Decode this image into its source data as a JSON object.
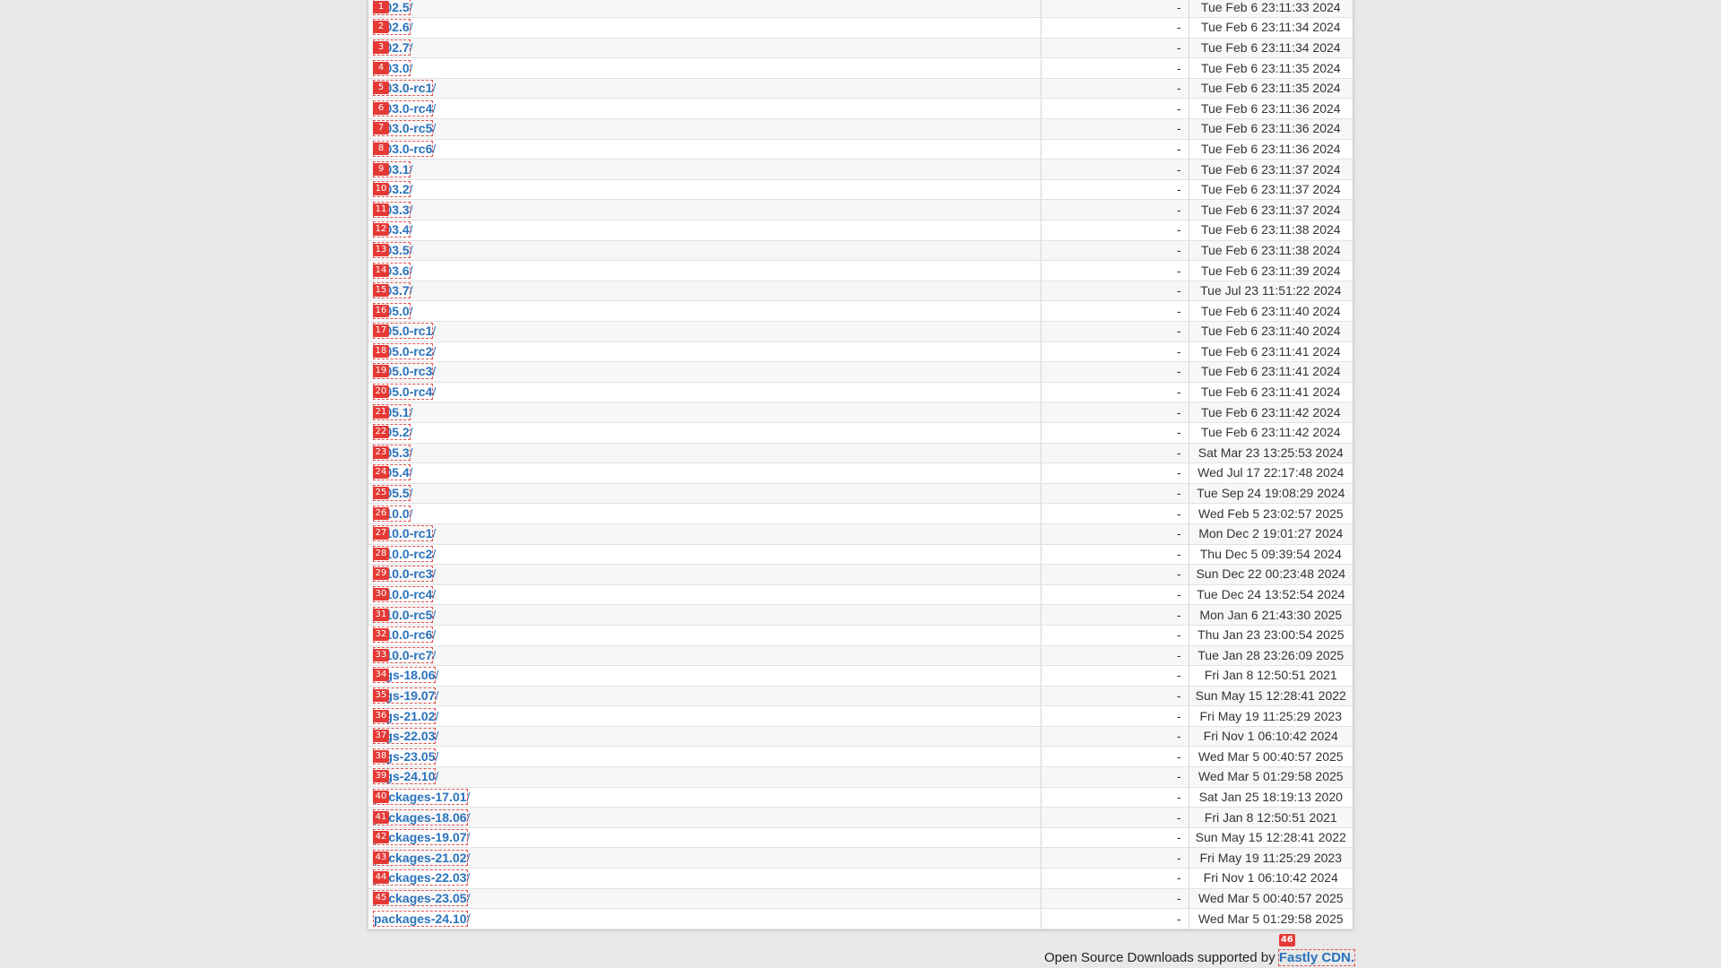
{
  "rows": [
    {
      "badge": "1",
      "name": "s-02.5",
      "size": "-",
      "date": "Tue Feb 6 23:11:33 2024"
    },
    {
      "badge": "2",
      "name": "s-02.6",
      "size": "-",
      "date": "Tue Feb 6 23:11:34 2024"
    },
    {
      "badge": "3",
      "name": "s-02.7",
      "size": "-",
      "date": "Tue Feb 6 23:11:34 2024"
    },
    {
      "badge": "4",
      "name": "s-03.0",
      "size": "-",
      "date": "Tue Feb 6 23:11:35 2024"
    },
    {
      "badge": "5",
      "name": "s-03.0-rc1",
      "size": "-",
      "date": "Tue Feb 6 23:11:35 2024"
    },
    {
      "badge": "6",
      "name": "s-03.0-rc4",
      "size": "-",
      "date": "Tue Feb 6 23:11:36 2024"
    },
    {
      "badge": "7",
      "name": "s-03.0-rc5",
      "size": "-",
      "date": "Tue Feb 6 23:11:36 2024"
    },
    {
      "badge": "8",
      "name": "s-03.0-rc6",
      "size": "-",
      "date": "Tue Feb 6 23:11:36 2024"
    },
    {
      "badge": "9",
      "name": "s-03.1",
      "size": "-",
      "date": "Tue Feb 6 23:11:37 2024"
    },
    {
      "badge": "10",
      "name": "s-03.2",
      "size": "-",
      "date": "Tue Feb 6 23:11:37 2024"
    },
    {
      "badge": "11",
      "name": "s-03.3",
      "size": "-",
      "date": "Tue Feb 6 23:11:37 2024"
    },
    {
      "badge": "12",
      "name": "s-03.4",
      "size": "-",
      "date": "Tue Feb 6 23:11:38 2024"
    },
    {
      "badge": "13",
      "name": "s-03.5",
      "size": "-",
      "date": "Tue Feb 6 23:11:38 2024"
    },
    {
      "badge": "14",
      "name": "s-03.6",
      "size": "-",
      "date": "Tue Feb 6 23:11:39 2024"
    },
    {
      "badge": "15",
      "name": "s-03.7",
      "size": "-",
      "date": "Tue Jul 23 11:51:22 2024"
    },
    {
      "badge": "16",
      "name": "s-05.0",
      "size": "-",
      "date": "Tue Feb 6 23:11:40 2024"
    },
    {
      "badge": "17",
      "name": "s-05.0-rc1",
      "size": "-",
      "date": "Tue Feb 6 23:11:40 2024"
    },
    {
      "badge": "18",
      "name": "s-05.0-rc2",
      "size": "-",
      "date": "Tue Feb 6 23:11:41 2024"
    },
    {
      "badge": "19",
      "name": "s-05.0-rc3",
      "size": "-",
      "date": "Tue Feb 6 23:11:41 2024"
    },
    {
      "badge": "20",
      "name": "s-05.0-rc4",
      "size": "-",
      "date": "Tue Feb 6 23:11:41 2024"
    },
    {
      "badge": "21",
      "name": "s-05.1",
      "size": "-",
      "date": "Tue Feb 6 23:11:42 2024"
    },
    {
      "badge": "22",
      "name": "s-05.2",
      "size": "-",
      "date": "Tue Feb 6 23:11:42 2024"
    },
    {
      "badge": "23",
      "name": "s-05.3",
      "size": "-",
      "date": "Sat Mar 23 13:25:53 2024"
    },
    {
      "badge": "24",
      "name": "s-05.4",
      "size": "-",
      "date": "Wed Jul 17 22:17:48 2024"
    },
    {
      "badge": "25",
      "name": "s-05.5",
      "size": "-",
      "date": "Tue Sep 24 19:08:29 2024"
    },
    {
      "badge": "26",
      "name": "s-10.0",
      "size": "-",
      "date": "Wed Feb 5 23:02:57 2025"
    },
    {
      "badge": "27",
      "name": "s-10.0-rc1",
      "size": "-",
      "date": "Mon Dec 2 19:01:27 2024"
    },
    {
      "badge": "28",
      "name": "s-10.0-rc2",
      "size": "-",
      "date": "Thu Dec 5 09:39:54 2024"
    },
    {
      "badge": "29",
      "name": "s-10.0-rc3",
      "size": "-",
      "date": "Sun Dec 22 00:23:48 2024"
    },
    {
      "badge": "30",
      "name": "s-10.0-rc4",
      "size": "-",
      "date": "Tue Dec 24 13:52:54 2024"
    },
    {
      "badge": "31",
      "name": "s-10.0-rc5",
      "size": "-",
      "date": "Mon Jan 6 21:43:30 2025"
    },
    {
      "badge": "32",
      "name": "s-10.0-rc6",
      "size": "-",
      "date": "Thu Jan 23 23:00:54 2025"
    },
    {
      "badge": "33",
      "name": "s-10.0-rc7",
      "size": "-",
      "date": "Tue Jan 28 23:26:09 2025"
    },
    {
      "badge": "34",
      "name": "logs-18.06",
      "size": "-",
      "date": "Fri Jan 8 12:50:51 2021"
    },
    {
      "badge": "35",
      "name": "logs-19.07",
      "size": "-",
      "date": "Sun May 15 12:28:41 2022"
    },
    {
      "badge": "36",
      "name": "logs-21.02",
      "size": "-",
      "date": "Fri May 19 11:25:29 2023"
    },
    {
      "badge": "37",
      "name": "logs-22.03",
      "size": "-",
      "date": "Fri Nov 1 06:10:42 2024"
    },
    {
      "badge": "38",
      "name": "logs-23.05",
      "size": "-",
      "date": "Wed Mar 5 00:40:57 2025"
    },
    {
      "badge": "39",
      "name": "logs-24.10",
      "size": "-",
      "date": "Wed Mar 5 01:29:58 2025"
    },
    {
      "badge": "40",
      "name": "packages-17.01",
      "size": "-",
      "date": "Sat Jan 25 18:19:13 2020"
    },
    {
      "badge": "41",
      "name": "packages-18.06",
      "size": "-",
      "date": "Fri Jan 8 12:50:51 2021"
    },
    {
      "badge": "42",
      "name": "packages-19.07",
      "size": "-",
      "date": "Sun May 15 12:28:41 2022"
    },
    {
      "badge": "43",
      "name": "packages-21.02",
      "size": "-",
      "date": "Fri May 19 11:25:29 2023"
    },
    {
      "badge": "44",
      "name": "packages-22.03",
      "size": "-",
      "date": "Fri Nov 1 06:10:42 2024"
    },
    {
      "badge": "45",
      "name": "packages-23.05",
      "size": "-",
      "date": "Wed Mar 5 00:40:57 2025"
    },
    {
      "badge": "",
      "name": "packages-24.10",
      "size": "-",
      "date": "Wed Mar 5 01:29:58 2025"
    }
  ],
  "slash": "/",
  "footer": {
    "text": "Open Source Downloads supported by",
    "link": "Fastly CDN.",
    "badge": "46"
  }
}
